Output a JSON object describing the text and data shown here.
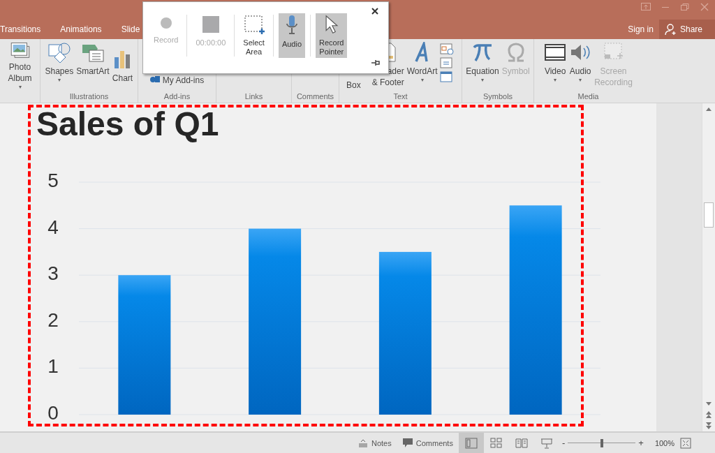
{
  "title_bar": {
    "tabs": [
      {
        "label": "Transitions",
        "selected": false
      },
      {
        "label": "Animations",
        "selected": false
      },
      {
        "label": "Slide",
        "selected": false
      }
    ],
    "sign_in": "Sign in",
    "share": "Share"
  },
  "ribbon": {
    "groups": [
      {
        "items": [
          {
            "kind": "photo",
            "lines": [
              "Photo",
              "Album"
            ],
            "caret": "▾",
            "disabled": false
          }
        ]
      },
      {
        "label": "Illustrations",
        "items": [
          {
            "kind": "shapes",
            "lines": [
              "Shapes"
            ],
            "caret": "▾",
            "disabled": false
          },
          {
            "kind": "smartart",
            "lines": [
              "SmartArt"
            ],
            "disabled": false
          },
          {
            "kind": "chart",
            "lines": [
              "Chart"
            ],
            "disabled": false
          }
        ]
      },
      {
        "label": "Add-ins",
        "items": [
          {
            "kind": "addins",
            "lines": [
              "My Add-ins"
            ],
            "disabled": false
          }
        ]
      },
      {
        "label": "Links"
      },
      {
        "label": "Comments"
      },
      {
        "label": "Text",
        "items": [
          {
            "kind": "textbox",
            "lines": [
              "Box"
            ],
            "disabled": false
          },
          {
            "kind": "header",
            "lines": [
              "ader",
              "& Footer"
            ],
            "disabled": false
          },
          {
            "kind": "wordart",
            "lines": [
              "WordArt"
            ],
            "caret": "▾",
            "disabled": false
          },
          {
            "kind": "smallstack"
          }
        ]
      },
      {
        "label": "Symbols",
        "items": [
          {
            "kind": "pi",
            "lines": [
              "Equation"
            ],
            "caret": "▾",
            "disabled": false
          },
          {
            "kind": "omega",
            "lines": [
              "Symbol"
            ],
            "disabled": true
          }
        ]
      },
      {
        "label": "Media",
        "items": [
          {
            "kind": "video",
            "lines": [
              "Video"
            ],
            "caret": "▾",
            "disabled": false
          },
          {
            "kind": "audio",
            "lines": [
              "Audio"
            ],
            "caret": "▾",
            "disabled": false
          },
          {
            "kind": "screenrec",
            "lines": [
              "Screen",
              "Recording"
            ],
            "disabled": true
          }
        ]
      }
    ]
  },
  "popup": {
    "buttons": [
      {
        "kind": "record",
        "lines": [
          "Record"
        ],
        "disabled": true,
        "on": false
      },
      {
        "kind": "stop",
        "lines": [
          "00:00:00"
        ],
        "disabled": true,
        "on": false
      },
      {
        "kind": "area",
        "lines": [
          "Select",
          "Area"
        ],
        "disabled": false,
        "on": false
      },
      {
        "kind": "audio",
        "lines": [
          "Audio"
        ],
        "disabled": false,
        "on": true
      },
      {
        "kind": "pointer",
        "lines": [
          "Record",
          "Pointer"
        ],
        "disabled": false,
        "on": true
      }
    ]
  },
  "slide": {
    "title": "Sales of Q1",
    "chart_data": {
      "type": "bar",
      "values": [
        3,
        4,
        3.5,
        4.5
      ],
      "ylim": [
        0,
        5
      ],
      "yticks": [
        0,
        1,
        2,
        3,
        4,
        5
      ],
      "grid": true
    }
  },
  "status_bar": {
    "notes": "Notes",
    "comments": "Comments",
    "views": [
      {
        "kind": "normal",
        "selected": true
      },
      {
        "kind": "sorter",
        "selected": false
      },
      {
        "kind": "reading",
        "selected": false
      },
      {
        "kind": "slideshow",
        "selected": false
      }
    ],
    "zoom": {
      "minus": "-",
      "plus": "+",
      "level": 0.5,
      "percent": "100%"
    }
  }
}
